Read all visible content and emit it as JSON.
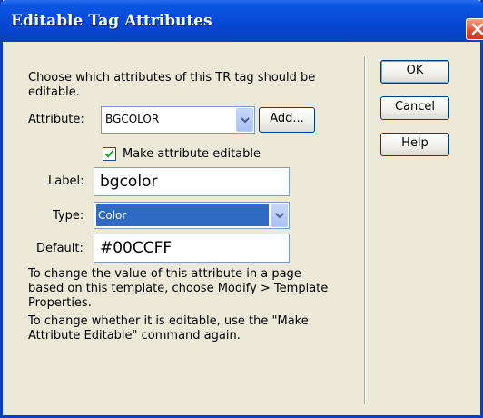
{
  "window": {
    "title": "Editable Tag Attributes",
    "close_icon": "close-icon"
  },
  "intro_text": "Choose which attributes of this TR tag should be editable.",
  "attribute": {
    "label": "Attribute:",
    "value": "BGCOLOR",
    "add_button": "Add..."
  },
  "make_editable": {
    "checked": true,
    "label": "Make attribute editable"
  },
  "label_field": {
    "label": "Label:",
    "value": "bgcolor"
  },
  "type_field": {
    "label": "Type:",
    "value": "Color"
  },
  "default_field": {
    "label": "Default:",
    "value": "#00CCFF"
  },
  "help_text_1": "To change the value of this attribute in a page based on this template, choose Modify > Template Properties.",
  "help_text_2": "To change whether it is editable, use the \"Make Attribute Editable\" command again.",
  "buttons": {
    "ok": "OK",
    "cancel": "Cancel",
    "help": "Help"
  },
  "colors": {
    "titlebar": "#0648d6",
    "dialog_bg": "#ece9d8",
    "selection": "#316ac5",
    "close": "#df4b2a"
  }
}
